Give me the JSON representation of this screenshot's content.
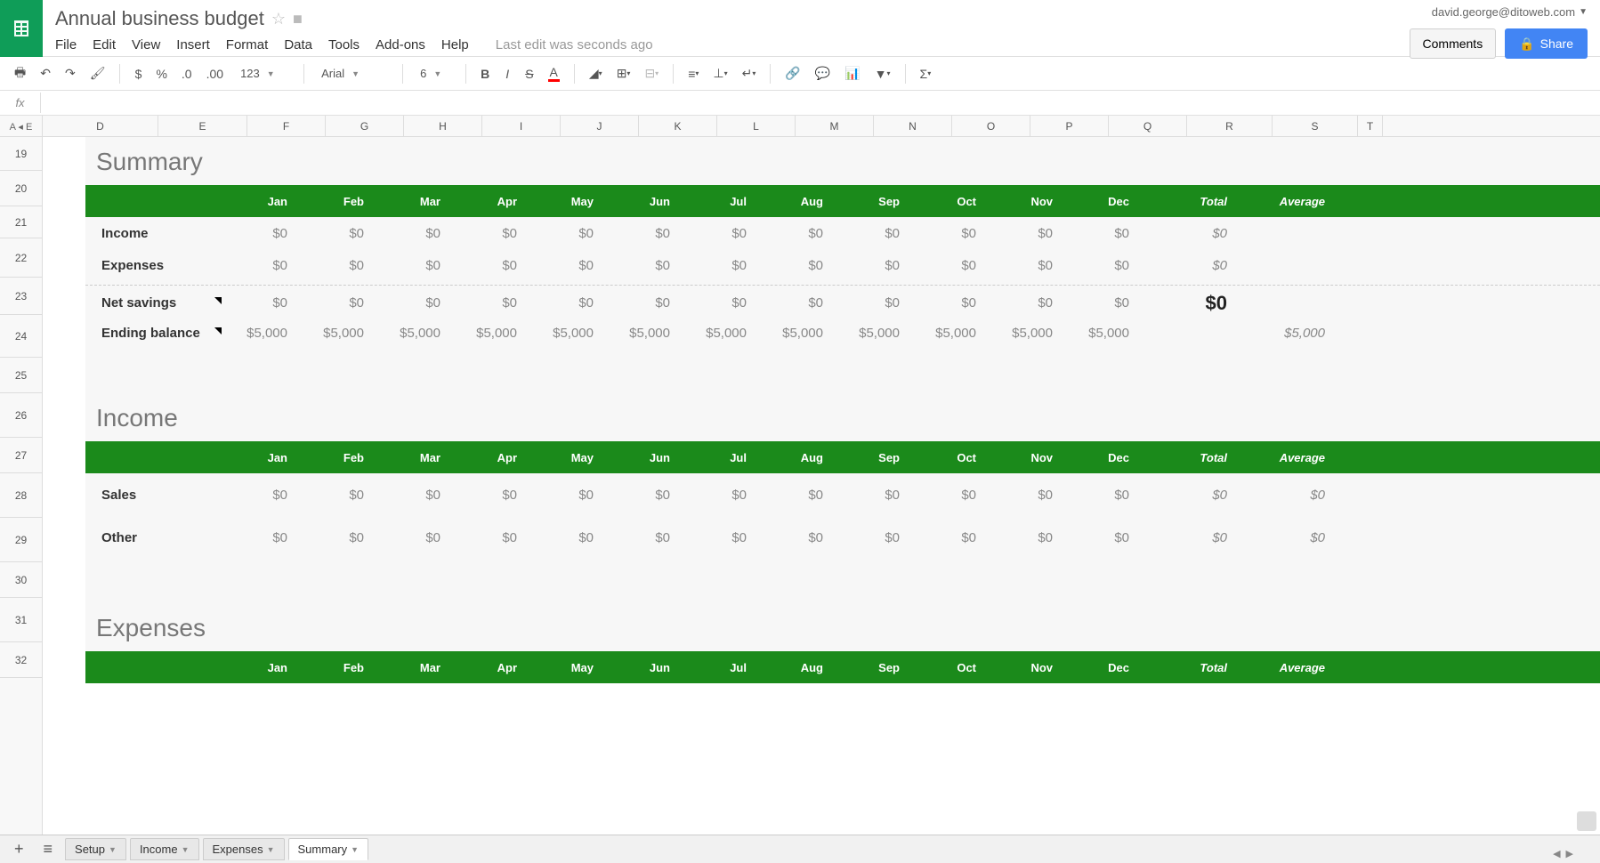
{
  "header": {
    "title": "Annual business budget",
    "user_email": "david.george@ditoweb.com",
    "comments_label": "Comments",
    "share_label": "Share",
    "edit_info": "Last edit was seconds ago"
  },
  "menu": [
    "File",
    "Edit",
    "View",
    "Insert",
    "Format",
    "Data",
    "Tools",
    "Add-ons",
    "Help"
  ],
  "toolbar": {
    "font_name": "Arial",
    "font_size": "6",
    "number_fmt": "123"
  },
  "columns": [
    "A",
    "E",
    "D",
    "E",
    "F",
    "G",
    "H",
    "I",
    "J",
    "K",
    "L",
    "M",
    "N",
    "O",
    "P",
    "Q",
    "R",
    "S",
    "T"
  ],
  "col_headers_display": [
    "D",
    "E",
    "F",
    "G",
    "H",
    "I",
    "J",
    "K",
    "L",
    "M",
    "N",
    "O",
    "P",
    "Q",
    "R",
    "S",
    "T"
  ],
  "row_numbers": [
    "19",
    "20",
    "21",
    "22",
    "23",
    "24",
    "25",
    "26",
    "27",
    "28",
    "29",
    "30",
    "31",
    "32"
  ],
  "months": [
    "Jan",
    "Feb",
    "Mar",
    "Apr",
    "May",
    "Jun",
    "Jul",
    "Aug",
    "Sep",
    "Oct",
    "Nov",
    "Dec"
  ],
  "total_label": "Total",
  "average_label": "Average",
  "sections": {
    "summary": {
      "title": "Summary",
      "rows": [
        {
          "label": "Income",
          "values": [
            "$0",
            "$0",
            "$0",
            "$0",
            "$0",
            "$0",
            "$0",
            "$0",
            "$0",
            "$0",
            "$0",
            "$0"
          ],
          "total": "$0",
          "average": ""
        },
        {
          "label": "Expenses",
          "values": [
            "$0",
            "$0",
            "$0",
            "$0",
            "$0",
            "$0",
            "$0",
            "$0",
            "$0",
            "$0",
            "$0",
            "$0"
          ],
          "total": "$0",
          "average": ""
        }
      ],
      "net_row": {
        "label": "Net savings",
        "values": [
          "$0",
          "$0",
          "$0",
          "$0",
          "$0",
          "$0",
          "$0",
          "$0",
          "$0",
          "$0",
          "$0",
          "$0"
        ],
        "total": "$0",
        "average": ""
      },
      "balance_row": {
        "label": "Ending balance",
        "values": [
          "$5,000",
          "$5,000",
          "$5,000",
          "$5,000",
          "$5,000",
          "$5,000",
          "$5,000",
          "$5,000",
          "$5,000",
          "$5,000",
          "$5,000",
          "$5,000"
        ],
        "total": "",
        "average": "$5,000"
      }
    },
    "income": {
      "title": "Income",
      "rows": [
        {
          "label": "Sales",
          "values": [
            "$0",
            "$0",
            "$0",
            "$0",
            "$0",
            "$0",
            "$0",
            "$0",
            "$0",
            "$0",
            "$0",
            "$0"
          ],
          "total": "$0",
          "average": "$0"
        },
        {
          "label": "Other",
          "values": [
            "$0",
            "$0",
            "$0",
            "$0",
            "$0",
            "$0",
            "$0",
            "$0",
            "$0",
            "$0",
            "$0",
            "$0"
          ],
          "total": "$0",
          "average": "$0"
        }
      ]
    },
    "expenses": {
      "title": "Expenses"
    }
  },
  "sheet_tabs": [
    "Setup",
    "Income",
    "Expenses",
    "Summary"
  ],
  "active_tab": "Summary"
}
